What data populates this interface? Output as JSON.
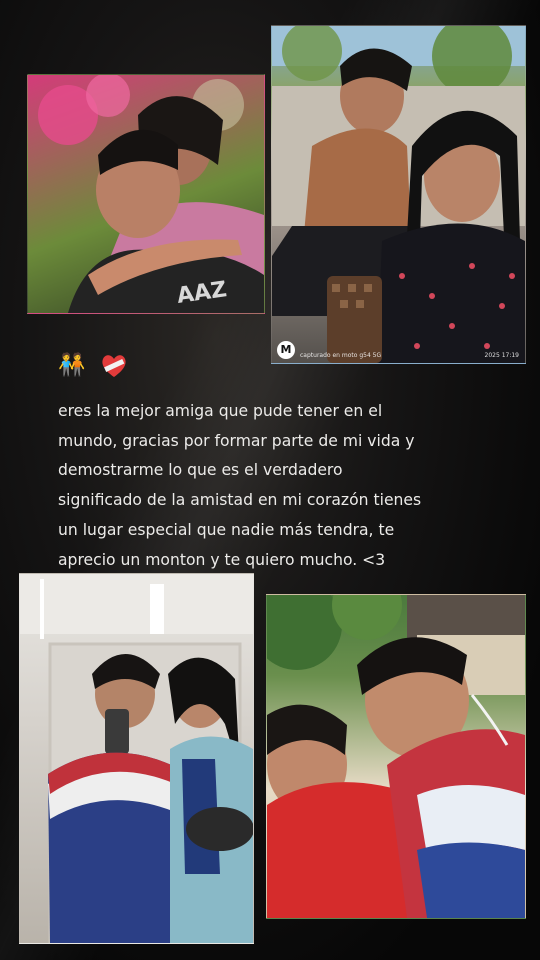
{
  "story": {
    "emoji_people": "🧑‍🤝‍🧑",
    "message": "eres la mejor amiga que pude tener en el\nmundo, gracias por formar parte de mi vida y\ndemostrarme lo que es el verdadero\nsignificado de la amistad en mi corazón tienes\nun lugar especial que nadie más tendra, te\naprecio un monton y te quiero mucho. <3",
    "photo2_watermark": "capturado en moto g54 5G",
    "photo2_timestamp": "2025 17:19"
  }
}
